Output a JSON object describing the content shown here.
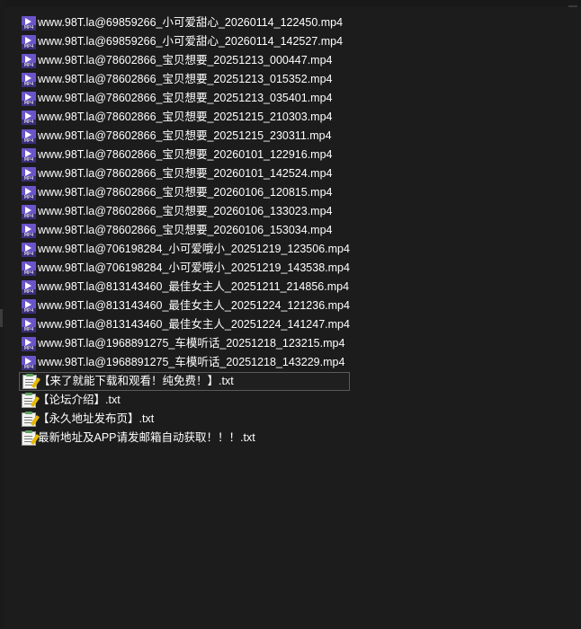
{
  "icons": {
    "video": "mp4-video-icon",
    "text": "text-file-icon"
  },
  "colors": {
    "background": "#1c1c1c",
    "text": "#ffffff",
    "mp4_icon": "#6b54c9",
    "selection_border": "#5a5a5a"
  },
  "mp4_icon_label": "MP4",
  "files": [
    {
      "name": "www.98T.la@69859266_小可爱甜心_20260114_122450.mp4",
      "type": "mp4"
    },
    {
      "name": "www.98T.la@69859266_小可爱甜心_20260114_142527.mp4",
      "type": "mp4"
    },
    {
      "name": "www.98T.la@78602866_宝贝想要_20251213_000447.mp4",
      "type": "mp4"
    },
    {
      "name": "www.98T.la@78602866_宝贝想要_20251213_015352.mp4",
      "type": "mp4"
    },
    {
      "name": "www.98T.la@78602866_宝贝想要_20251213_035401.mp4",
      "type": "mp4"
    },
    {
      "name": "www.98T.la@78602866_宝贝想要_20251215_210303.mp4",
      "type": "mp4"
    },
    {
      "name": "www.98T.la@78602866_宝贝想要_20251215_230311.mp4",
      "type": "mp4"
    },
    {
      "name": "www.98T.la@78602866_宝贝想要_20260101_122916.mp4",
      "type": "mp4"
    },
    {
      "name": "www.98T.la@78602866_宝贝想要_20260101_142524.mp4",
      "type": "mp4"
    },
    {
      "name": "www.98T.la@78602866_宝贝想要_20260106_120815.mp4",
      "type": "mp4"
    },
    {
      "name": "www.98T.la@78602866_宝贝想要_20260106_133023.mp4",
      "type": "mp4"
    },
    {
      "name": "www.98T.la@78602866_宝贝想要_20260106_153034.mp4",
      "type": "mp4"
    },
    {
      "name": "www.98T.la@706198284_小可爱哦小_20251219_123506.mp4",
      "type": "mp4"
    },
    {
      "name": "www.98T.la@706198284_小可爱哦小_20251219_143538.mp4",
      "type": "mp4"
    },
    {
      "name": "www.98T.la@813143460_最佳女主人_20251211_214856.mp4",
      "type": "mp4"
    },
    {
      "name": "www.98T.la@813143460_最佳女主人_20251224_121236.mp4",
      "type": "mp4"
    },
    {
      "name": "www.98T.la@813143460_最佳女主人_20251224_141247.mp4",
      "type": "mp4"
    },
    {
      "name": "www.98T.la@1968891275_车模听话_20251218_123215.mp4",
      "type": "mp4"
    },
    {
      "name": "www.98T.la@1968891275_车模听话_20251218_143229.mp4",
      "type": "mp4"
    },
    {
      "name": "【来了就能下载和观看！纯免费！】.txt",
      "type": "txt",
      "selected": true
    },
    {
      "name": "【论坛介绍】.txt",
      "type": "txt"
    },
    {
      "name": "【永久地址发布页】.txt",
      "type": "txt"
    },
    {
      "name": "最新地址及APP请发邮箱自动获取！！！.txt",
      "type": "txt"
    }
  ]
}
